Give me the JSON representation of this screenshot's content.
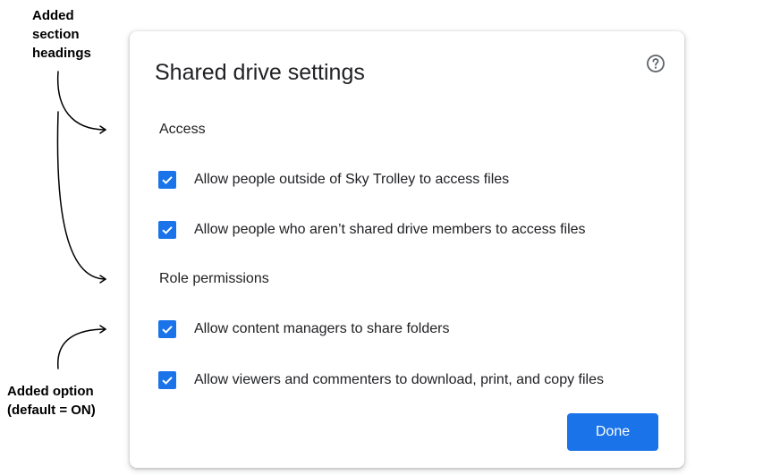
{
  "annotations": {
    "headings_note": [
      "Added",
      "section",
      "headings"
    ],
    "option_note": [
      "Added option",
      "(default = ON)"
    ]
  },
  "dialog": {
    "title": "Shared drive settings",
    "help_icon": "help-circle-icon",
    "sections": [
      {
        "heading": "Access",
        "options": [
          {
            "label": "Allow people outside of Sky Trolley to access files",
            "checked": true
          },
          {
            "label": "Allow people who aren’t shared drive members to access files",
            "checked": true
          }
        ]
      },
      {
        "heading": "Role permissions",
        "options": [
          {
            "label": "Allow content managers to share folders",
            "checked": true
          },
          {
            "label": "Allow viewers and commenters to download, print, and copy files",
            "checked": true
          }
        ]
      }
    ],
    "done_label": "Done"
  },
  "colors": {
    "accent": "#1a73e8",
    "text": "#202124",
    "icon": "#5f6368"
  }
}
